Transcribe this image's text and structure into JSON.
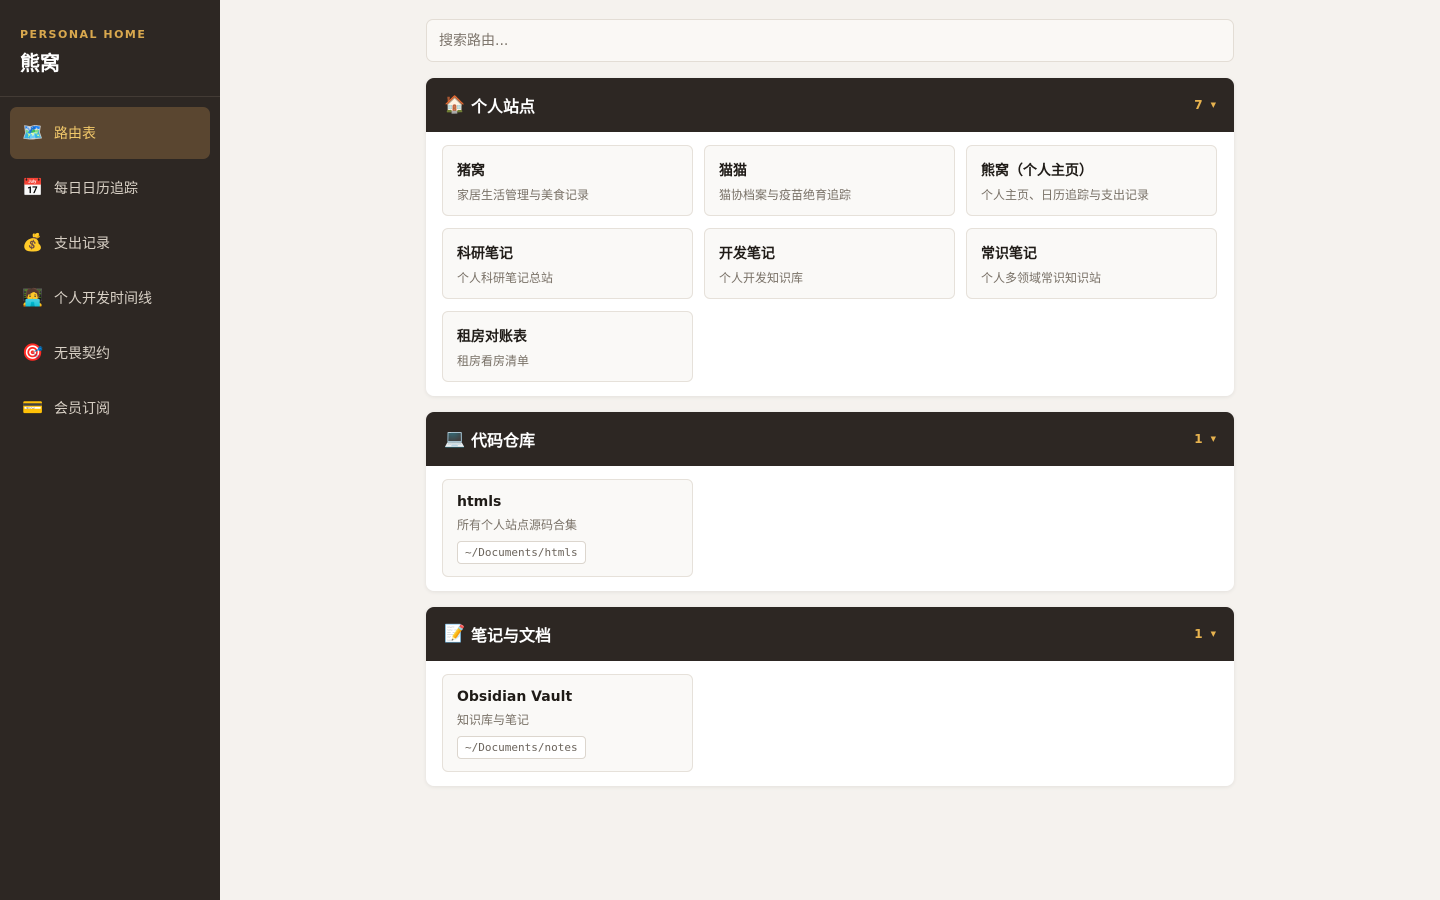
{
  "brand": {
    "subtitle": "PERSONAL HOME",
    "title": "熊窝"
  },
  "nav": [
    {
      "icon": "🗺️",
      "icon_name": "map-icon",
      "label": "路由表",
      "active": true
    },
    {
      "icon": "📅",
      "icon_name": "calendar-icon",
      "label": "每日日历追踪"
    },
    {
      "icon": "💰",
      "icon_name": "money-bag-icon",
      "label": "支出记录"
    },
    {
      "icon": "🧑‍💻",
      "icon_name": "developer-icon",
      "label": "个人开发时间线"
    },
    {
      "icon": "🎯",
      "icon_name": "target-icon",
      "label": "无畏契约"
    },
    {
      "icon": "💳",
      "icon_name": "credit-card-icon",
      "label": "会员订阅"
    }
  ],
  "search": {
    "placeholder": "搜索路由...",
    "value": ""
  },
  "sections": [
    {
      "icon": "🏠",
      "icon_name": "house-icon",
      "title": "个人站点",
      "count": "7",
      "cards": [
        {
          "title": "猪窝",
          "desc": "家居生活管理与美食记录"
        },
        {
          "title": "猫猫",
          "desc": "猫协档案与疫苗绝育追踪"
        },
        {
          "title": "熊窝（个人主页）",
          "desc": "个人主页、日历追踪与支出记录"
        },
        {
          "title": "科研笔记",
          "desc": "个人科研笔记总站"
        },
        {
          "title": "开发笔记",
          "desc": "个人开发知识库"
        },
        {
          "title": "常识笔记",
          "desc": "个人多领域常识知识站"
        },
        {
          "title": "租房对账表",
          "desc": "租房看房清单"
        }
      ]
    },
    {
      "icon": "💻",
      "icon_name": "laptop-icon",
      "title": "代码仓库",
      "count": "1",
      "cards": [
        {
          "title": "htmls",
          "desc": "所有个人站点源码合集",
          "path": "~/Documents/htmls"
        }
      ]
    },
    {
      "icon": "📝",
      "icon_name": "memo-icon",
      "title": "笔记与文档",
      "count": "1",
      "cards": [
        {
          "title": "Obsidian Vault",
          "desc": "知识库与笔记",
          "path": "~/Documents/notes"
        }
      ]
    }
  ],
  "colors": {
    "sidebar_bg": "#2d2723",
    "accent": "#e7b34f",
    "page_bg": "#f5f2ee"
  }
}
